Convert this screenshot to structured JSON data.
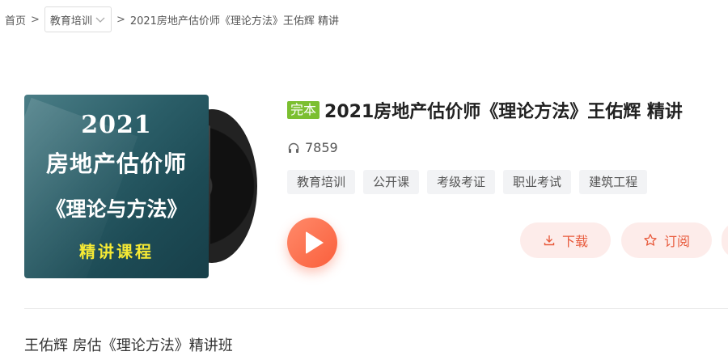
{
  "breadcrumb": {
    "home": "首页",
    "sep1": ">",
    "category": "教育培训",
    "sep2": ">",
    "current": "2021房地产估价师《理论方法》王佑辉 精讲"
  },
  "cover": {
    "year": "2021",
    "line1": "房地产估价师",
    "line2": "《理论与方法》",
    "line3": "精讲课程"
  },
  "album": {
    "badge": "完本",
    "title": "2021房地产估价师《理论方法》王佑辉 精讲",
    "play_count": "7859",
    "tags": [
      "教育培训",
      "公开课",
      "考级考证",
      "职业考试",
      "建筑工程"
    ]
  },
  "actions": {
    "download": "下载",
    "subscribe": "订阅"
  },
  "description": "王佑辉 房估《理论方法》精讲班",
  "colors": {
    "badge": "#7bbf30",
    "accent": "#fa5f3c",
    "action_bg": "#fdecea"
  }
}
